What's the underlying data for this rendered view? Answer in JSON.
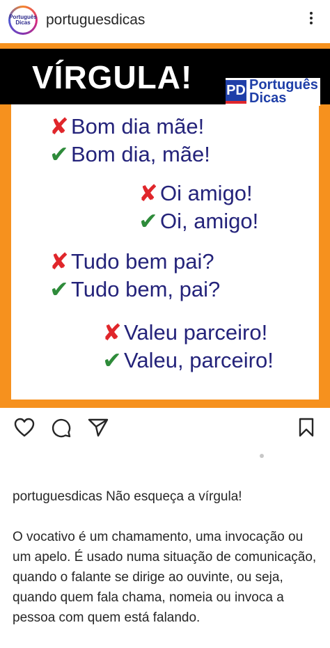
{
  "header": {
    "username": "portuguesdicas",
    "avatar_logo_line1": "Português",
    "avatar_logo_line2": "Dicas"
  },
  "post": {
    "title": "VÍRGULA!",
    "brand_line1": "Português",
    "brand_line2": "Dicas",
    "brand_badge": "PD",
    "lines": [
      {
        "mark": "✘",
        "text": "Bom dia mãe!"
      },
      {
        "mark": "✔",
        "text": "Bom dia, mãe!"
      },
      {
        "mark": "✘",
        "text": "Oi amigo!"
      },
      {
        "mark": "✔",
        "text": "Oi, amigo!"
      },
      {
        "mark": "✘",
        "text": "Tudo bem pai?"
      },
      {
        "mark": "✔",
        "text": "Tudo bem, pai?"
      },
      {
        "mark": "✘",
        "text": "Valeu parceiro!"
      },
      {
        "mark": "✔",
        "text": "Valeu, parceiro!"
      }
    ],
    "colors": {
      "orange": "#f6911e",
      "wrong": "#e0262b",
      "right": "#2e8b3a",
      "text": "#24237a"
    }
  },
  "actions": {
    "icons": [
      "heart-icon",
      "comment-icon",
      "share-icon",
      "bookmark-icon"
    ]
  },
  "caption": {
    "username": "portuguesdicas",
    "headline": "Não esqueça a vírgula!",
    "body": "O vocativo é um chamamento, uma invocação ou um apelo. É usado numa situação de comunicação, quando o falante se dirige ao ouvinte, ou seja, quando quem fala chama, nomeia ou invoca a pessoa com quem está falando."
  }
}
